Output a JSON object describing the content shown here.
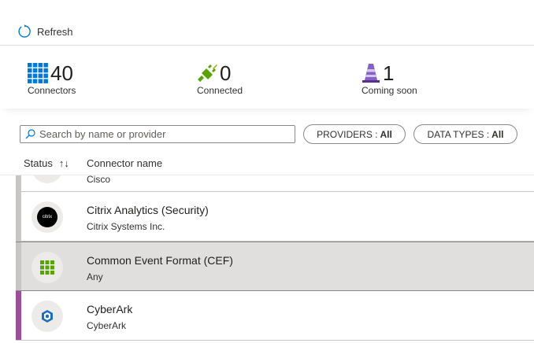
{
  "toolbar": {
    "refresh_label": "Refresh",
    "refresh_icon": "refresh-icon"
  },
  "stats": {
    "connectors": {
      "count": "40",
      "label": "Connectors",
      "icon": "grid-icon",
      "color": "#0078d4"
    },
    "connected": {
      "count": "0",
      "label": "Connected",
      "icon": "plug-icon",
      "color": "#57a300"
    },
    "coming_soon": {
      "count": "1",
      "label": "Coming soon",
      "icon": "cone-icon",
      "color": "#8661c5"
    }
  },
  "filters": {
    "search_placeholder": "Search by name or provider",
    "providers_label": "PROVIDERS :",
    "providers_value": "All",
    "datatypes_label": "DATA TYPES :",
    "datatypes_value": "All"
  },
  "grid": {
    "col_status": "Status",
    "col_name": "Connector name",
    "sort_icon": "↑↓"
  },
  "rows": [
    {
      "name": "",
      "provider": "Cisco",
      "status": "not-connected"
    },
    {
      "name": "Citrix Analytics (Security)",
      "provider": "Citrix Systems Inc.",
      "status": "not-connected",
      "logo_text": "citrix"
    },
    {
      "name": "Common Event Format (CEF)",
      "provider": "Any",
      "status": "not-connected",
      "selected": true
    },
    {
      "name": "CyberArk",
      "provider": "CyberArk",
      "status": "coming-soon"
    }
  ],
  "colors": {
    "accent": "#0078d4",
    "coming_soon_bar": "#9b4f96",
    "selected_row": "#e1dfdd"
  }
}
